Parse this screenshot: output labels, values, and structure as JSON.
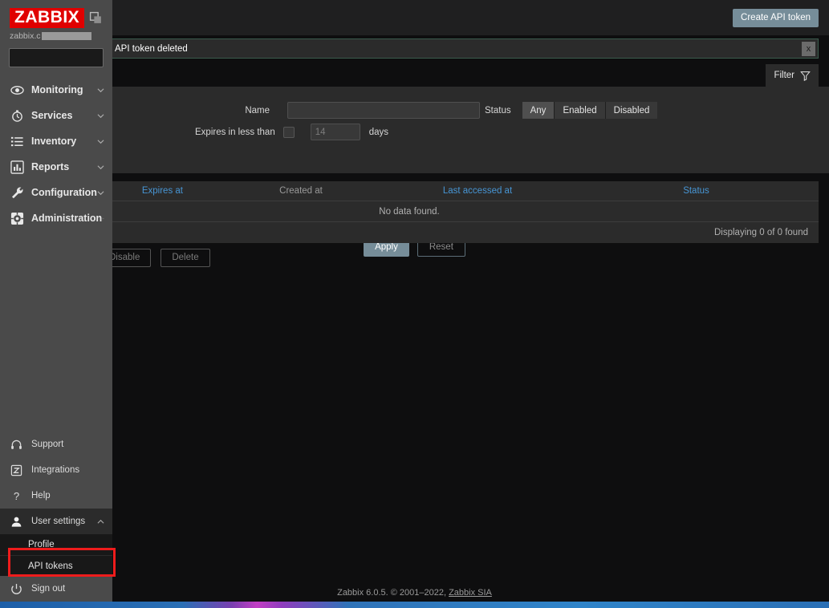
{
  "sidebar": {
    "logo": "ZABBIX",
    "collapse_icon": "collapse-sidebar-icon",
    "host": {
      "prefix": "zabbix.c",
      "suffix": ""
    },
    "search": {
      "value": "",
      "placeholder": "",
      "icon": "search-icon"
    },
    "nav": [
      {
        "label": "Monitoring",
        "icon": "eye-icon"
      },
      {
        "label": "Services",
        "icon": "stopwatch-icon"
      },
      {
        "label": "Inventory",
        "icon": "list-icon"
      },
      {
        "label": "Reports",
        "icon": "bar-chart-icon"
      },
      {
        "label": "Configuration",
        "icon": "wrench-icon"
      },
      {
        "label": "Administration",
        "icon": "gear-icon"
      }
    ],
    "bottom": [
      {
        "label": "Support",
        "icon": "headset-icon"
      },
      {
        "label": "Integrations",
        "icon": "z-badge-icon"
      },
      {
        "label": "Help",
        "icon": "question-icon"
      }
    ],
    "user_settings": {
      "label": "User settings",
      "icon": "user-icon",
      "expanded": true
    },
    "submenu": [
      {
        "label": "Profile"
      },
      {
        "label": "API tokens",
        "highlighted": true
      }
    ],
    "sign_out": {
      "label": "Sign out",
      "icon": "power-icon"
    }
  },
  "header": {
    "create_button": "Create API token"
  },
  "message": {
    "text": "API token deleted",
    "close_label": "x",
    "border_color": "#3b5c4d"
  },
  "filter": {
    "tab_label": "Filter",
    "tab_icon": "funnel-icon",
    "name_label": "Name",
    "name_value": "",
    "name_placeholder": "",
    "status_label": "Status",
    "status_options": [
      "Any",
      "Enabled",
      "Disabled"
    ],
    "status_selected": "Any",
    "expires_label": "Expires in less than",
    "expires_value": "",
    "expires_placeholder": "14",
    "expires_checked": false,
    "days_label": "days",
    "apply_label": "Apply",
    "reset_label": "Reset"
  },
  "table": {
    "columns": [
      {
        "label": "Expires at",
        "sortable": true
      },
      {
        "label": "Created at",
        "sortable": false
      },
      {
        "label": "Last accessed at",
        "sortable": true
      },
      {
        "label": "Status",
        "sortable": true
      }
    ],
    "rows": [],
    "empty_text": "No data found.",
    "displaying_text": "Displaying 0 of 0 found"
  },
  "actions": {
    "disable_label": "Disable",
    "delete_label": "Delete"
  },
  "footer": {
    "text": "Zabbix 6.0.5. © 2001–2022, ",
    "link": "Zabbix SIA"
  },
  "colors": {
    "accent_red": "#e00000",
    "button_blue": "#768d99",
    "link_blue": "#4795d4",
    "annotation_red": "#ee1c1c"
  }
}
